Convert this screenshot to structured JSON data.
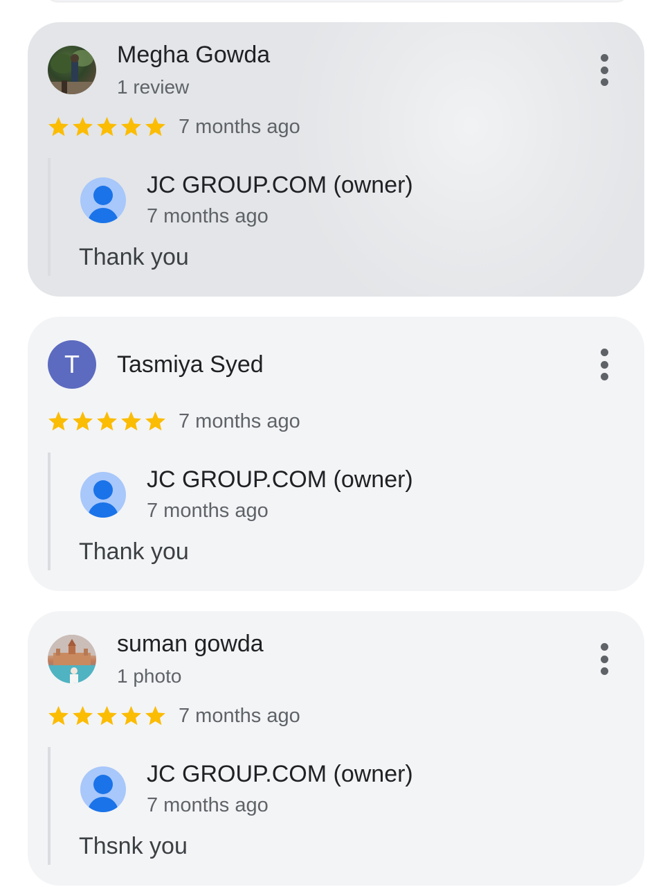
{
  "colors": {
    "star": "#fbbc04",
    "card_bg": "#f3f4f6",
    "letter_avatar": "#5c6bc0",
    "owner_avatar_bg": "#a8c7fa",
    "owner_avatar_fg": "#1a73e8"
  },
  "reviews": [
    {
      "reviewer_name": "Megha Gowda",
      "reviewer_sub": "1 review",
      "avatar": "photo",
      "rating": 5,
      "date": "7 months ago",
      "owner_reply": {
        "name": "JC GROUP.COM (owner)",
        "date": "7 months ago",
        "text": "Thank you"
      }
    },
    {
      "reviewer_name": "Tasmiya Syed",
      "avatar_letter": "T",
      "rating": 5,
      "date": "7 months ago",
      "owner_reply": {
        "name": "JC GROUP.COM (owner)",
        "date": "7 months ago",
        "text": "Thank you"
      }
    },
    {
      "reviewer_name": "suman gowda",
      "reviewer_sub": "1 photo",
      "avatar": "photo",
      "rating": 5,
      "date": "7 months ago",
      "owner_reply": {
        "name": "JC GROUP.COM (owner)",
        "date": "7 months ago",
        "text": "Thsnk you"
      }
    }
  ],
  "icons": {
    "more": "more-vert-icon",
    "star": "star-icon",
    "owner_avatar": "account-circle-icon"
  }
}
